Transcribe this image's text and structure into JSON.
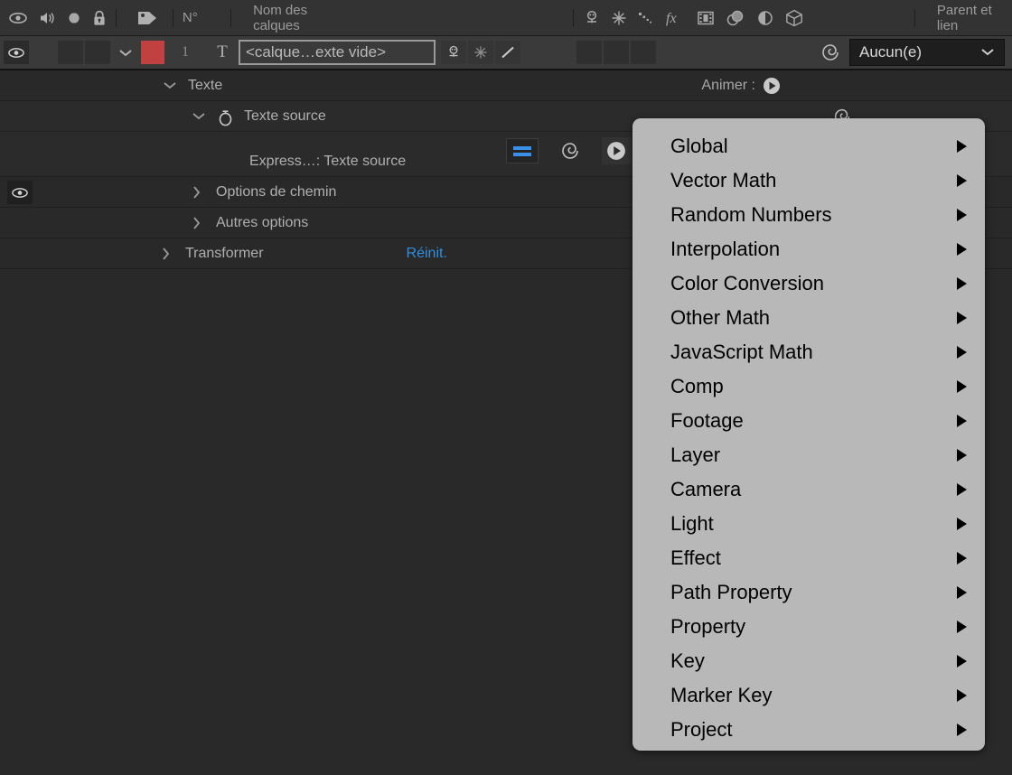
{
  "columns": {
    "icons": [
      "eye-icon",
      "audio-icon",
      "solo-icon",
      "lock-icon",
      "label-tag-icon"
    ],
    "number_label": "N°",
    "name_label": "Nom des calques",
    "switch_icons": [
      "shy-icon",
      "collapse-transform-icon",
      "quality-icon",
      "effects-fx-icon",
      "frame-blend-icon",
      "motion-blur-icon",
      "adjustment-layer-icon",
      "3d-layer-icon"
    ],
    "parent_label": "Parent et lien"
  },
  "layer": {
    "visible": true,
    "color": "#c0413f",
    "number": "1",
    "type_glyph": "T",
    "name": "<calque…exte vide>",
    "parent_value": "Aucun(e)",
    "parent_placeholder": "Aucun(e)"
  },
  "properties": {
    "texte": {
      "label": "Texte",
      "animer_label": "Animer :"
    },
    "texte_source": {
      "label": "Texte source"
    },
    "expression": {
      "label": "Express…: Texte source"
    },
    "options_chemin": {
      "label": "Options de chemin"
    },
    "autres_options": {
      "label": "Autres options"
    },
    "transformer": {
      "label": "Transformer",
      "reset_label": "Réinit."
    }
  },
  "menu": {
    "items": [
      {
        "label": "Global",
        "has_submenu": true
      },
      {
        "label": "Vector Math",
        "has_submenu": true
      },
      {
        "label": "Random Numbers",
        "has_submenu": true
      },
      {
        "label": "Interpolation",
        "has_submenu": true
      },
      {
        "label": "Color Conversion",
        "has_submenu": true
      },
      {
        "label": "Other Math",
        "has_submenu": true
      },
      {
        "label": "JavaScript Math",
        "has_submenu": true
      },
      {
        "label": "Comp",
        "has_submenu": true
      },
      {
        "label": "Footage",
        "has_submenu": true
      },
      {
        "label": "Layer",
        "has_submenu": true
      },
      {
        "label": "Camera",
        "has_submenu": true
      },
      {
        "label": "Light",
        "has_submenu": true
      },
      {
        "label": "Effect",
        "has_submenu": true
      },
      {
        "label": "Path Property",
        "has_submenu": true
      },
      {
        "label": "Property",
        "has_submenu": true
      },
      {
        "label": "Key",
        "has_submenu": true
      },
      {
        "label": "Marker Key",
        "has_submenu": true
      },
      {
        "label": "Project",
        "has_submenu": true
      }
    ],
    "background": "#b8b8b8",
    "text_color": "#000000"
  },
  "colors": {
    "panel_bg": "#292929",
    "header_bg": "#333333",
    "row_bg": "#3a3a3a",
    "accent_blue": "#2f8fe0",
    "expression_blue": "#3a8fe8",
    "layer_color": "#c0413f"
  }
}
